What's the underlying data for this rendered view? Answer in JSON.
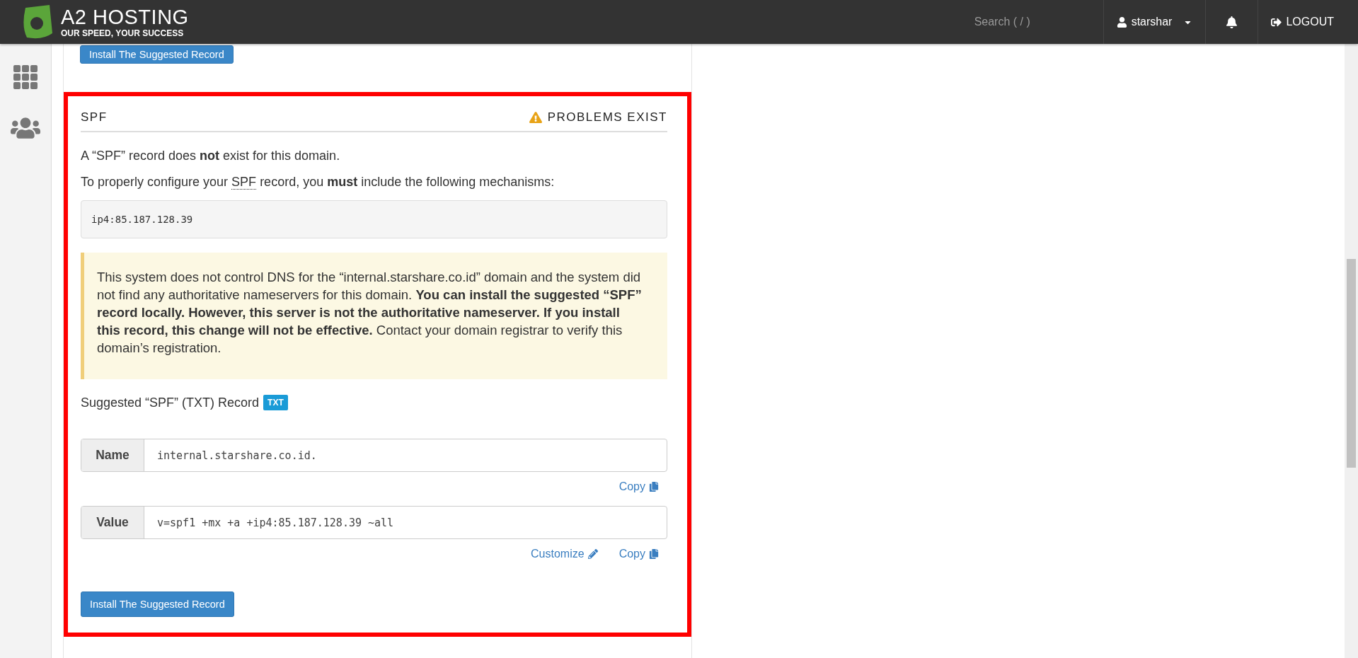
{
  "header": {
    "brand": "A2 HOSTING",
    "tagline": "OUR SPEED, YOUR SUCCESS",
    "search": {
      "placeholder": "Search ( / )"
    },
    "user": "starshar",
    "logout": "LOGOUT"
  },
  "top_button": "Install The Suggested Record",
  "spf": {
    "highlighted": true,
    "title": "SPF",
    "status": "PROBLEMS EXIST",
    "intro": "A “SPF” record does **not** exist for this domain.",
    "instruction": {
      "before": "To properly configure your ",
      "abbr": "SPF",
      "after": " record, you **must** include the following mechanisms:"
    },
    "mechanisms": "ip4:85.187.128.39",
    "warning": "This system does not control DNS for the “internal.starshare.co.id” domain and the system did not find any authoritative nameservers for this domain. **You can install the suggested “SPF” record locally. However, this server is not the authoritative nameserver. If you install this record, this change will not be effective.** Contact your domain registrar to verify this domain’s registration.",
    "suggested": "Suggested “SPF” (TXT) Record",
    "badge": "TXT",
    "fields": [
      {
        "label": "Name",
        "value": "internal.starshare.co.id.",
        "actions": [
          {
            "kind": "copy",
            "label": "Copy"
          }
        ]
      },
      {
        "label": "Value",
        "value": "v=spf1 +mx +a +ip4:85.187.128.39 ~all",
        "actions": [
          {
            "kind": "customize",
            "label": "Customize"
          },
          {
            "kind": "copy",
            "label": "Copy"
          }
        ]
      }
    ],
    "install": "Install The Suggested Record"
  }
}
